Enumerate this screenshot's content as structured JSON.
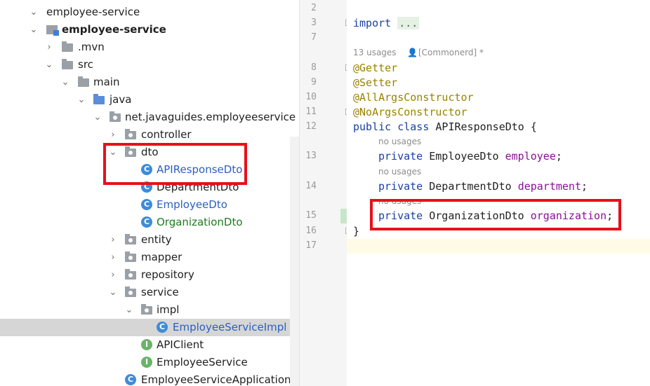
{
  "project_tree": {
    "items": [
      {
        "label": "employee-service",
        "level": 0,
        "icon": "folder-icon",
        "chevron": "expanded"
      },
      {
        "label": "employee-service",
        "level": 1,
        "icon": "module-icon",
        "chevron": "expanded",
        "bold": true
      },
      {
        "label": ".mvn",
        "level": 2,
        "icon": "folder-icon",
        "chevron": "collapsed"
      },
      {
        "label": "src",
        "level": 2,
        "icon": "folder-icon",
        "chevron": "expanded"
      },
      {
        "label": "main",
        "level": 3,
        "icon": "folder-icon",
        "chevron": "expanded"
      },
      {
        "label": "java",
        "level": 4,
        "icon": "source-folder-icon",
        "chevron": "expanded"
      },
      {
        "label": "net.javaguides.employeeservice",
        "level": 5,
        "icon": "package-icon",
        "chevron": "expanded"
      },
      {
        "label": "controller",
        "level": 6,
        "icon": "package-icon",
        "chevron": "collapsed"
      },
      {
        "label": "dto",
        "level": 6,
        "icon": "package-icon",
        "chevron": "expanded"
      },
      {
        "label": "APIResponseDto",
        "level": 7,
        "icon": "class-icon",
        "color": "blue"
      },
      {
        "label": "DepartmentDto",
        "level": 7,
        "icon": "class-icon"
      },
      {
        "label": "EmployeeDto",
        "level": 7,
        "icon": "class-icon",
        "color": "blue"
      },
      {
        "label": "OrganizationDto",
        "level": 7,
        "icon": "class-icon",
        "color": "green"
      },
      {
        "label": "entity",
        "level": 6,
        "icon": "package-icon",
        "chevron": "collapsed"
      },
      {
        "label": "mapper",
        "level": 6,
        "icon": "package-icon",
        "chevron": "collapsed"
      },
      {
        "label": "repository",
        "level": 6,
        "icon": "package-icon",
        "chevron": "collapsed"
      },
      {
        "label": "service",
        "level": 6,
        "icon": "package-icon",
        "chevron": "expanded"
      },
      {
        "label": "impl",
        "level": 7,
        "icon": "package-icon",
        "chevron": "expanded"
      },
      {
        "label": "EmployeeServiceImpl",
        "level": 8,
        "icon": "class-icon",
        "color": "blue",
        "selected": true
      },
      {
        "label": "APIClient",
        "level": 7,
        "icon": "interface-icon"
      },
      {
        "label": "EmployeeService",
        "level": 7,
        "icon": "interface-icon"
      },
      {
        "label": "EmployeeServiceApplication",
        "level": 6,
        "icon": "spring-class-icon"
      }
    ],
    "icon_glyphs": {
      "class": "C",
      "interface": "I"
    }
  },
  "editor": {
    "line_numbers": [
      "2",
      "3",
      "7",
      "8",
      "9",
      "10",
      "11",
      "12",
      "13",
      "14",
      "15",
      "16",
      "17"
    ],
    "code": {
      "import_kw": "import",
      "import_fold": "...",
      "usages_hint": "13 usages",
      "author_hint": "[Commonerd] *",
      "annotations": [
        "@Getter",
        "@Setter",
        "@AllArgsConstructor",
        "@NoArgsConstructor"
      ],
      "class_decl": {
        "kw1": "public",
        "kw2": "class",
        "name": "APIResponseDto {"
      },
      "no_usages": "no usages",
      "fields": [
        {
          "kw": "private",
          "type": "EmployeeDto",
          "name": "employee",
          ";": ";"
        },
        {
          "kw": "private",
          "type": "DepartmentDto",
          "name": "department",
          ";": ";"
        },
        {
          "kw": "private",
          "type": "OrganizationDto",
          "name": "organization",
          ";": ";"
        }
      ],
      "closing_brace": "}"
    }
  },
  "colors": {
    "highlight_box": "#e8101a",
    "keyword": "#1a3fa0",
    "annotation": "#9a8300",
    "field": "#871094"
  }
}
